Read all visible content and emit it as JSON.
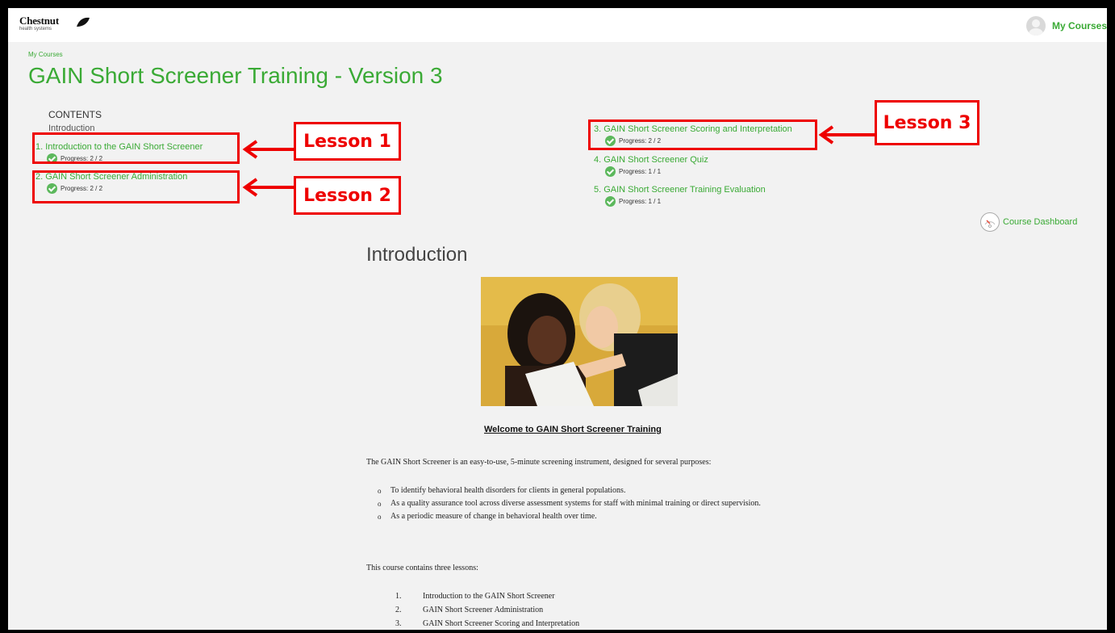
{
  "header": {
    "logo_text": "Chestnut",
    "logo_sub": "health systems",
    "user_link": "My Courses"
  },
  "breadcrumb": "My Courses",
  "course_title": "GAIN Short Screener Training - Version 3",
  "contents": {
    "heading": "CONTENTS",
    "intro": "Introduction",
    "lessons": [
      {
        "label": "1. Introduction to the GAIN Short Screener",
        "progress": "Progress: 2 / 2"
      },
      {
        "label": "2. GAIN Short Screener Administration",
        "progress": "Progress: 2 / 2"
      },
      {
        "label": "3. GAIN Short Screener Scoring and Interpretation",
        "progress": "Progress: 2 / 2"
      },
      {
        "label": "4. GAIN Short Screener Quiz",
        "progress": "Progress: 1 / 1"
      },
      {
        "label": "5. GAIN Short Screener Training Evaluation",
        "progress": "Progress: 1 / 1"
      }
    ]
  },
  "annotations": {
    "lesson1": "Lesson 1",
    "lesson2": "Lesson 2",
    "lesson3": "Lesson 3",
    "color": "#e00000"
  },
  "dashboard_link": "Course Dashboard",
  "main": {
    "heading": "Introduction",
    "welcome": "Welcome to GAIN Short Screener Training",
    "paragraph": "The GAIN Short Screener is an easy-to-use, 5-minute screening instrument, designed for several purposes:",
    "bullets": [
      "To identify behavioral health disorders for clients in general populations.",
      "As a quality assurance tool across diverse assessment systems for staff with minimal training or direct supervision.",
      "As a periodic measure of change in behavioral health over time."
    ],
    "paragraph2": "This course contains three lessons:",
    "lessons": [
      {
        "num": "1.",
        "text": "Introduction to the GAIN Short Screener"
      },
      {
        "num": "2.",
        "text": "GAIN Short Screener Administration"
      },
      {
        "num": "3.",
        "text": "GAIN Short Screener Scoring and Interpretation"
      }
    ]
  },
  "colors": {
    "accent": "#3aaa35",
    "background": "#f2f2f2",
    "check": "#5cb85c"
  }
}
